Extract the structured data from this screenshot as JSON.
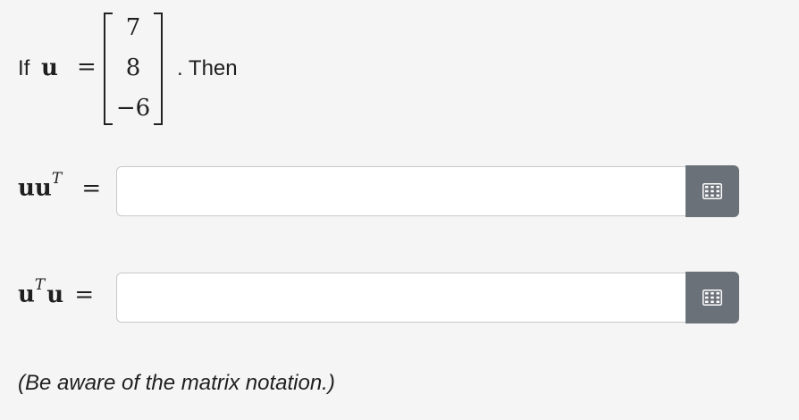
{
  "problem": {
    "if_word": "If",
    "vector_symbol": "u",
    "equals": "=",
    "vector_entries": [
      "7",
      "8",
      "−6"
    ],
    "then_text": ". Then"
  },
  "answers": [
    {
      "base": "uu",
      "sup": "T",
      "suffix": "",
      "equals": "=",
      "value": "",
      "button_icon": "matrix-grid-icon"
    },
    {
      "base": "u",
      "sup": "T",
      "suffix": "u",
      "equals": "=",
      "value": "",
      "button_icon": "matrix-grid-icon"
    }
  ],
  "note": "(Be aware of the matrix notation.)",
  "colors": {
    "background": "#f5f5f5",
    "button": "#6b7178",
    "input_border": "#c9c9c9"
  }
}
